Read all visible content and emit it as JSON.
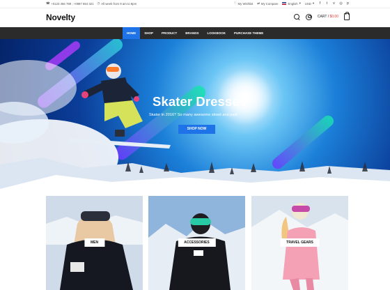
{
  "topbar": {
    "phone": "+0123 456 789 ; +0987 654 321",
    "hours": "All week from 9 am to 9pm",
    "wishlist": "My Wishlist",
    "compare": "My Compare",
    "language": "English",
    "currency": "USD"
  },
  "header": {
    "logo": "Novelty",
    "cart_label": "CART /",
    "cart_amount": "$0.00"
  },
  "nav": {
    "items": [
      {
        "label": "HOME"
      },
      {
        "label": "SHOP"
      },
      {
        "label": "PRODUCT"
      },
      {
        "label": "BRANDS"
      },
      {
        "label": "LOOKBOOK"
      },
      {
        "label": "PURCHASE THEME"
      }
    ]
  },
  "hero": {
    "title": "Skater Dresses",
    "subtitle": "Skater in 2016? So many awesome street and park",
    "button": "SHOP NOW"
  },
  "categories": [
    {
      "label": "MEN"
    },
    {
      "label": "ACCESSORIES"
    },
    {
      "label": "TRAVEL GEARS"
    }
  ],
  "colors": {
    "accent": "#1e73e8",
    "nav_bg": "#2b2b2b",
    "price": "#e53935"
  }
}
